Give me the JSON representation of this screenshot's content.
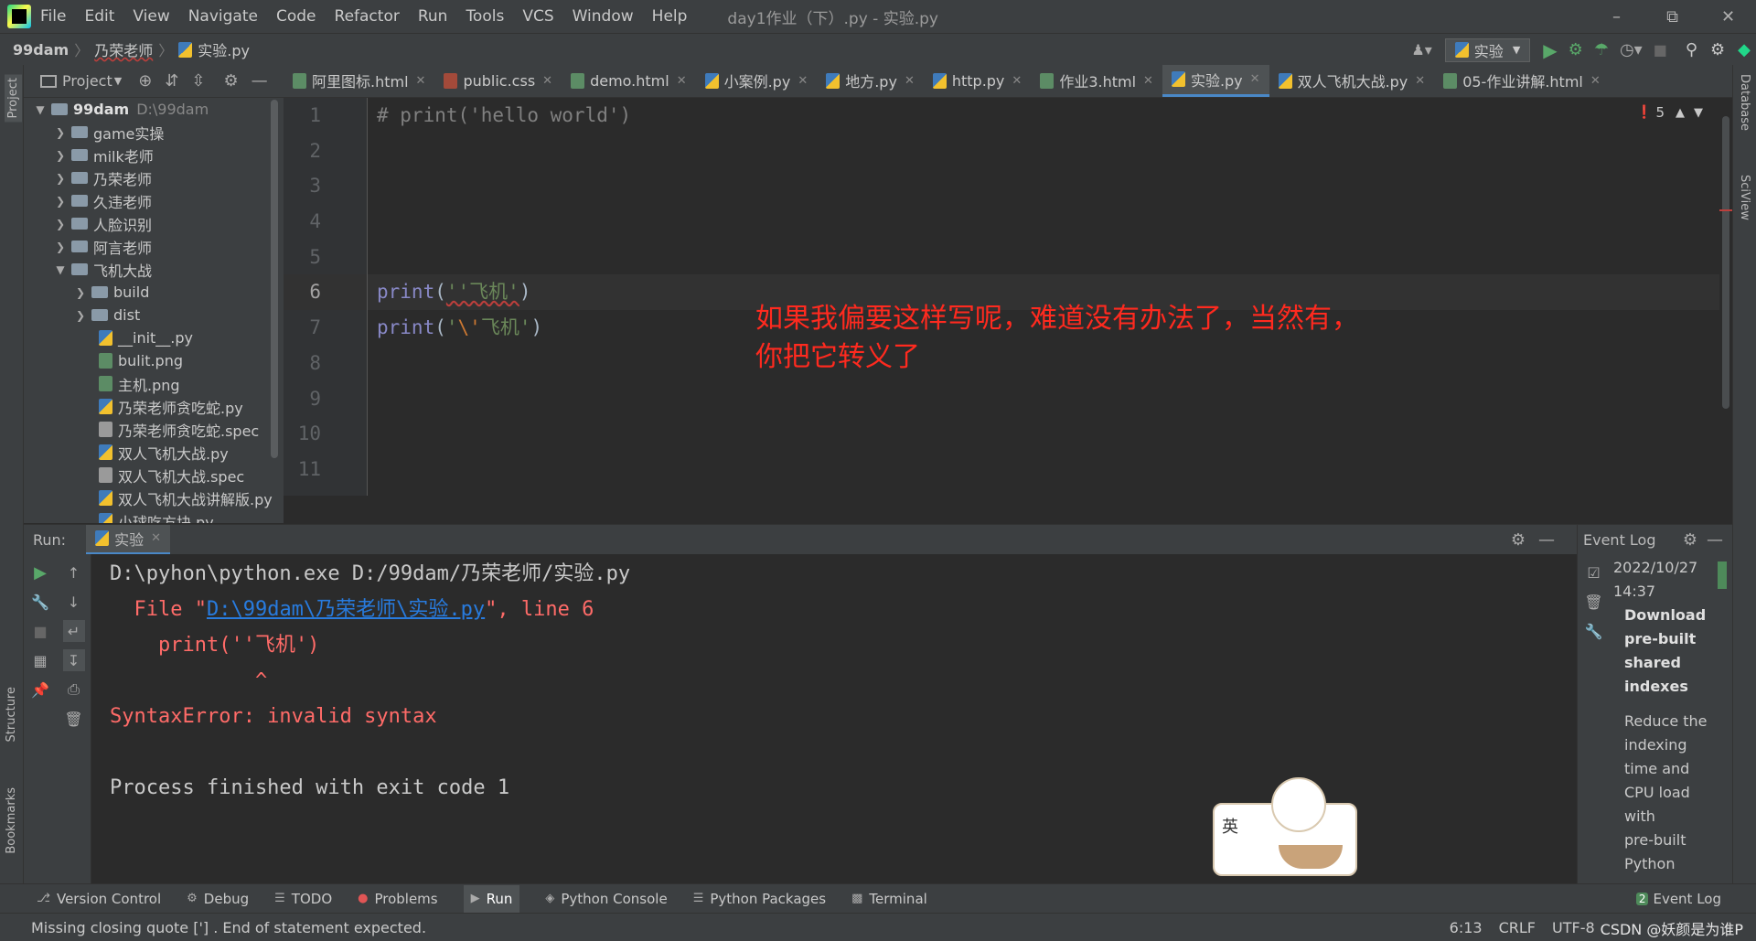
{
  "menubar": {
    "items": [
      "File",
      "Edit",
      "View",
      "Navigate",
      "Code",
      "Refactor",
      "Run",
      "Tools",
      "VCS",
      "Window",
      "Help"
    ],
    "window_title": "day1作业（下）.py - 实验.py"
  },
  "navbar": {
    "crumbs": [
      "99dam",
      "乃荣老师",
      "实验.py"
    ],
    "run_config": "实验"
  },
  "project": {
    "header": "Project",
    "root_name": "99dam",
    "root_path": "D:\\99dam",
    "items": [
      {
        "label": "game实操",
        "type": "folder"
      },
      {
        "label": "milk老师",
        "type": "folder"
      },
      {
        "label": "乃荣老师",
        "type": "folder"
      },
      {
        "label": "久违老师",
        "type": "folder"
      },
      {
        "label": "人脸识别",
        "type": "folder"
      },
      {
        "label": "阿言老师",
        "type": "folder"
      },
      {
        "label": "飞机大战",
        "type": "folder-open"
      },
      {
        "label": "build",
        "type": "folder"
      },
      {
        "label": "dist",
        "type": "folder"
      },
      {
        "label": "__init__.py",
        "type": "py"
      },
      {
        "label": "bulit.png",
        "type": "img"
      },
      {
        "label": "主机.png",
        "type": "img"
      },
      {
        "label": "乃荣老师贪吃蛇.py",
        "type": "py"
      },
      {
        "label": "乃荣老师贪吃蛇.spec",
        "type": "spec"
      },
      {
        "label": "双人飞机大战.py",
        "type": "py"
      },
      {
        "label": "双人飞机大战.spec",
        "type": "spec"
      },
      {
        "label": "双人飞机大战讲解版.py",
        "type": "py"
      },
      {
        "label": "小球吃方块.py",
        "type": "py"
      }
    ]
  },
  "tabs": [
    {
      "label": "阿里图标.html",
      "kind": "html"
    },
    {
      "label": "public.css",
      "kind": "css"
    },
    {
      "label": "demo.html",
      "kind": "html"
    },
    {
      "label": "小案例.py",
      "kind": "py"
    },
    {
      "label": "地方.py",
      "kind": "py"
    },
    {
      "label": "http.py",
      "kind": "py"
    },
    {
      "label": "作业3.html",
      "kind": "html"
    },
    {
      "label": "实验.py",
      "kind": "py",
      "active": true
    },
    {
      "label": "双人飞机大战.py",
      "kind": "py"
    },
    {
      "label": "05-作业讲解.html",
      "kind": "html"
    }
  ],
  "editor": {
    "line_numbers": [
      "1",
      "2",
      "3",
      "4",
      "5",
      "6",
      "7",
      "8",
      "9",
      "10",
      "11"
    ],
    "line1": "# print('hello world')",
    "line6_fn": "print",
    "line6_open": "(",
    "line6_str": "''飞机'",
    "line6_close": ")",
    "line7_fn": "print",
    "line7_open": "(",
    "line7_str_a": "'",
    "line7_esc": "\\'",
    "line7_str_b": "飞机'",
    "line7_close": ")",
    "error_count": "5",
    "annotation_line1": "如果我偏要这样写呢，难道没有办法了，当然有，",
    "annotation_line2": "你把它转义了"
  },
  "run": {
    "label": "Run:",
    "tab": "实验",
    "lines": {
      "cmd": "D:\\pyhon\\python.exe D:/99dam/乃荣老师/实验.py",
      "file_prefix": "  File \"",
      "file_link": "D:\\99dam\\乃荣老师\\实验.py",
      "file_suffix": "\", line 6",
      "code": "    print(''飞机')",
      "caret": "            ^",
      "error": "SyntaxError: invalid syntax",
      "finish": "Process finished with exit code 1"
    }
  },
  "event_log": {
    "title": "Event Log",
    "date": "2022/10/27",
    "time": "14:37",
    "headline": [
      "Download",
      "pre-built",
      "shared",
      "indexes"
    ],
    "body": [
      "Reduce the",
      " indexing",
      "time and",
      "CPU load",
      "with",
      "pre-built",
      "Python"
    ]
  },
  "toolwindows": [
    "Version Control",
    "Debug",
    "TODO",
    "Problems",
    "Run",
    "Python Console",
    "Python Packages",
    "Terminal"
  ],
  "event_log_button": "Event Log",
  "event_log_badge": "2",
  "status": {
    "message": "Missing closing quote ['] . End of statement expected.",
    "position": "6:13",
    "line_sep": "CRLF",
    "encoding": "UTF-8",
    "watermark": "CSDN @妖颜是为谁P"
  },
  "side_labels": {
    "project": "Project",
    "structure": "Structure",
    "bookmarks": "Bookmarks",
    "database": "Database",
    "sciview": "SciView"
  },
  "sticker_text": "英",
  "colors": {
    "accent": "#4a88c7",
    "error": "#ff6b68",
    "annotation": "#ff2a1f",
    "link": "#287bde"
  }
}
